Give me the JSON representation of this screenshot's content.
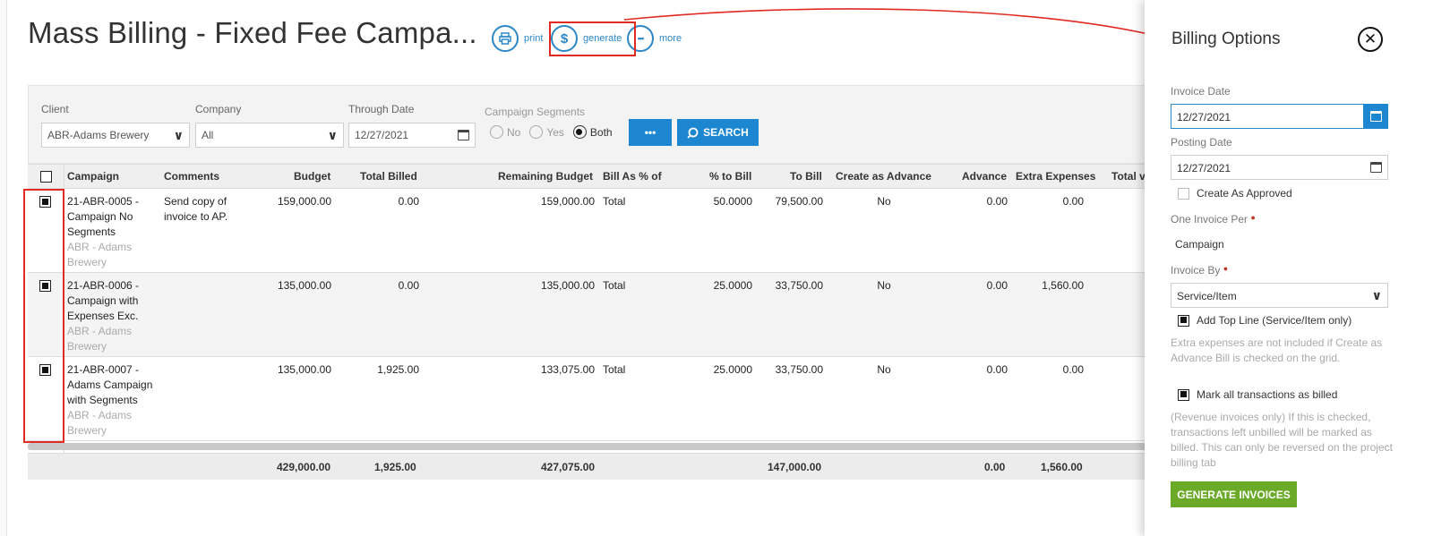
{
  "page": {
    "title": "Mass Billing - Fixed Fee Campa..."
  },
  "toolbar": {
    "print_label": "print",
    "generate_label": "generate",
    "generate_icon": "$",
    "more_label": "more",
    "more_icon": "•••"
  },
  "filters": {
    "client_label": "Client",
    "client_value": "ABR-Adams Brewery",
    "company_label": "Company",
    "company_value": "All",
    "through_date_label": "Through Date",
    "through_date_value": "12/27/2021",
    "segments_label": "Campaign Segments",
    "segment_options": [
      "No",
      "Yes",
      "Both"
    ],
    "segment_selected": "Both",
    "more_button_label": "•••",
    "search_button_label": "SEARCH"
  },
  "grid": {
    "columns": [
      "Campaign",
      "Comments",
      "Budget",
      "Total Billed",
      "Remaining Budget",
      "Bill As % of",
      "% to Bill",
      "To Bill",
      "Create as Advance",
      "Advance",
      "Extra Expenses",
      "Total v"
    ],
    "rows": [
      {
        "checked": true,
        "campaign": "21-ABR-0005 - Campaign No Segments",
        "client": "ABR - Adams Brewery",
        "comments": "Send copy of invoice to AP.",
        "budget": "159,000.00",
        "total_billed": "0.00",
        "remaining_budget": "159,000.00",
        "bill_as": "Total",
        "pct_to_bill": "50.0000",
        "to_bill": "79,500.00",
        "create_as_advance": "No",
        "advance": "0.00",
        "extra_expenses": "0.00"
      },
      {
        "checked": true,
        "campaign": "21-ABR-0006 - Campaign with Expenses Exc.",
        "client": "ABR - Adams Brewery",
        "comments": "",
        "budget": "135,000.00",
        "total_billed": "0.00",
        "remaining_budget": "135,000.00",
        "bill_as": "Total",
        "pct_to_bill": "25.0000",
        "to_bill": "33,750.00",
        "create_as_advance": "No",
        "advance": "0.00",
        "extra_expenses": "1,560.00"
      },
      {
        "checked": true,
        "campaign": "21-ABR-0007 - Adams Campaign with Segments",
        "client": "ABR - Adams Brewery",
        "comments": "",
        "budget": "135,000.00",
        "total_billed": "1,925.00",
        "remaining_budget": "133,075.00",
        "bill_as": "Total",
        "pct_to_bill": "25.0000",
        "to_bill": "33,750.00",
        "create_as_advance": "No",
        "advance": "0.00",
        "extra_expenses": "0.00"
      }
    ],
    "totals": {
      "budget": "429,000.00",
      "total_billed": "1,925.00",
      "remaining_budget": "427,075.00",
      "to_bill": "147,000.00",
      "advance": "0.00",
      "extra_expenses": "1,560.00"
    }
  },
  "drawer": {
    "title": "Billing Options",
    "invoice_date_label": "Invoice Date",
    "invoice_date_value": "12/27/2021",
    "posting_date_label": "Posting Date",
    "posting_date_value": "12/27/2021",
    "create_as_approved_label": "Create As Approved",
    "one_invoice_per_label": "One Invoice Per",
    "one_invoice_per_value": "Campaign",
    "invoice_by_label": "Invoice By",
    "invoice_by_value": "Service/Item",
    "add_top_line_label": "Add Top Line (Service/Item only)",
    "extra_expenses_note": "Extra expenses are not included if Create as Advance Bill is checked on the grid.",
    "mark_billed_label": "Mark all transactions as billed",
    "mark_billed_note": "(Revenue invoices only) If this is checked, transactions left unbilled will be marked as billed. This can only be reversed on the project billing tab",
    "generate_button_label": "GENERATE INVOICES",
    "required_marker": "●"
  },
  "colors": {
    "accent_blue": "#1c87d0",
    "highlight_red": "#e02a22",
    "generate_green": "#6aaa28"
  },
  "icons": {
    "print": "printer-icon",
    "generate": "dollar-icon",
    "more": "more-icon",
    "calendar": "calendar-icon",
    "close": "close-icon",
    "chevron": "chevron-down-icon",
    "search": "search-icon"
  }
}
